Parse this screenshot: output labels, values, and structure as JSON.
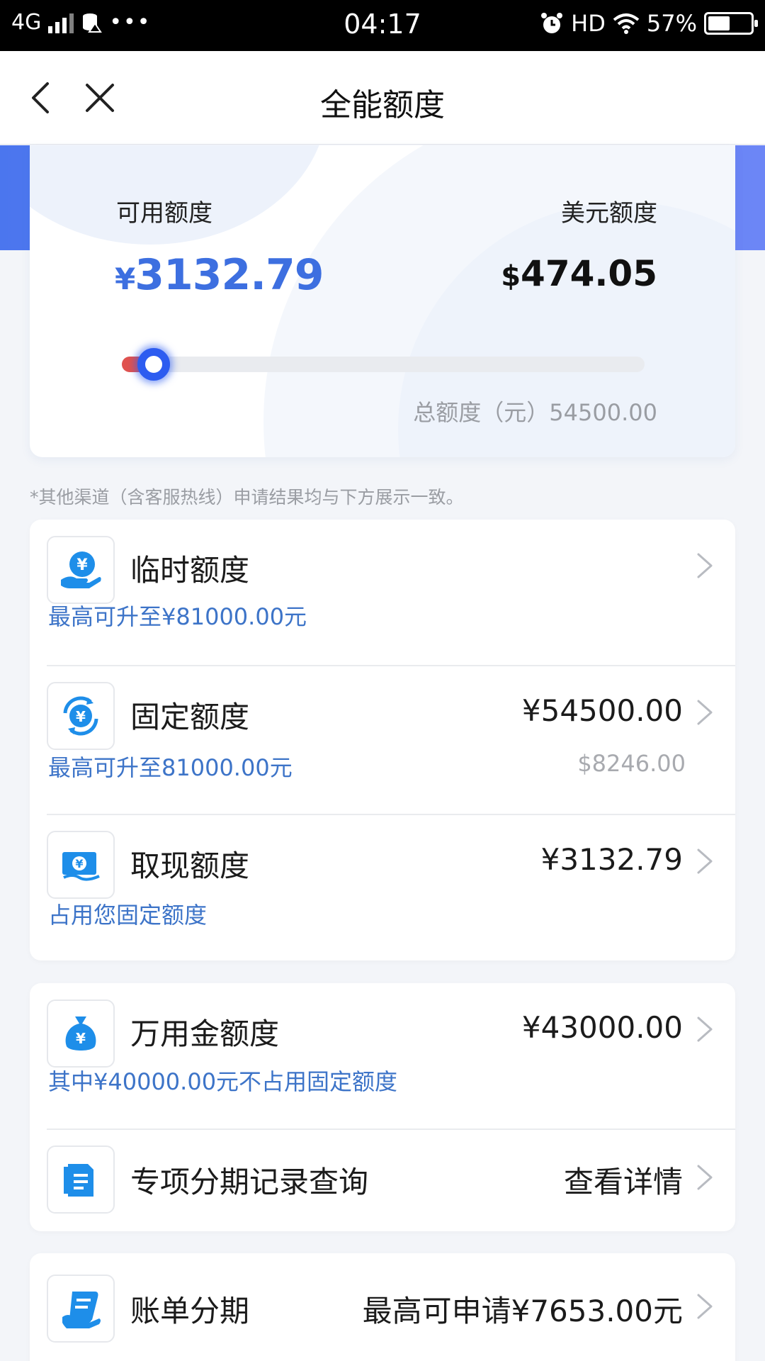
{
  "status_bar": {
    "network": "4G",
    "time": "04:17",
    "hd": "HD",
    "battery": "57%",
    "battery_level": 0.57
  },
  "nav": {
    "title": "全能额度"
  },
  "summary": {
    "available_label": "可用额度",
    "available_currency": "¥",
    "available_value": "3132.79",
    "usd_label": "美元额度",
    "usd_currency": "$",
    "usd_value": "474.05",
    "usage_fraction": 0.057,
    "total_text": "总额度（元）54500.00"
  },
  "note": "*其他渠道（含客服热线）申请结果均与下方展示一致。",
  "card1": {
    "temp": {
      "title": "临时额度",
      "sub": "最高可升至¥81000.00元",
      "icon": "hand-yuan-icon"
    },
    "fixed": {
      "title": "固定额度",
      "value": "¥54500.00",
      "sub": "最高可升至81000.00元",
      "sub_value": "$8246.00",
      "icon": "yuan-cycle-icon"
    },
    "cash": {
      "title": "取现额度",
      "value": "¥3132.79",
      "sub": "占用您固定额度",
      "icon": "cash-note-icon"
    }
  },
  "card2": {
    "wanyong": {
      "title": "万用金额度",
      "value": "¥43000.00",
      "sub": "其中¥40000.00元不占用固定额度",
      "icon": "money-bag-icon"
    },
    "installment_query": {
      "title": "专项分期记录查询",
      "value": "查看详情",
      "icon": "document-icon"
    }
  },
  "card3": {
    "bill_installment": {
      "title": "账单分期",
      "value": "最高可申请¥7653.00元",
      "icon": "bill-scroll-icon"
    }
  },
  "colors": {
    "accent_blue": "#3d6fe0",
    "link_blue": "#3d74c8",
    "progress_used": "#e0524f",
    "knob": "#2d5cf0"
  }
}
